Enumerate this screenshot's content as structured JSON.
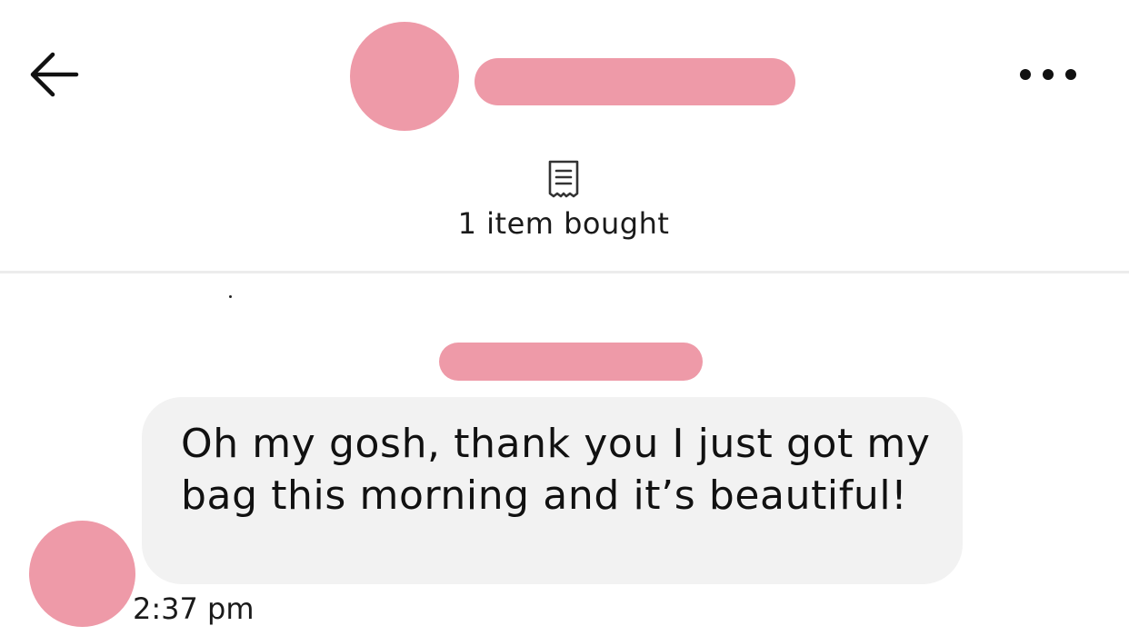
{
  "theme": {
    "redaction_color": "#ee9aa8",
    "bubble_color": "#f2f2f2",
    "text_color": "#111111"
  },
  "header": {
    "back_icon": "arrow-left-icon",
    "more_icon": "more-horizontal-icon"
  },
  "order": {
    "icon": "receipt-icon",
    "summary": "1 item bought"
  },
  "message": {
    "text": "Oh my gosh, thank you I just got my bag this morning and it’s beautiful!",
    "time": "2:37 pm"
  }
}
